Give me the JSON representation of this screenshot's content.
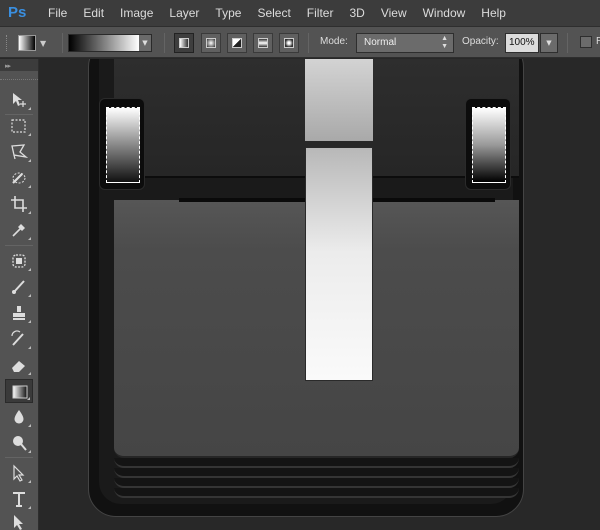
{
  "app": {
    "logo": "Ps"
  },
  "menu": [
    "File",
    "Edit",
    "Image",
    "Layer",
    "Type",
    "Select",
    "Filter",
    "3D",
    "View",
    "Window",
    "Help"
  ],
  "options": {
    "mode_label": "Mode:",
    "mode_value": "Normal",
    "opacity_label": "Opacity:",
    "opacity_value": "100%",
    "reverse_label": "R"
  },
  "tools": [
    "move-tool",
    "marquee-tool",
    "lasso-tool",
    "quick-selection-tool",
    "crop-tool",
    "eyedropper-tool",
    "healing-brush-tool",
    "brush-tool",
    "clone-stamp-tool",
    "history-brush-tool",
    "eraser-tool",
    "gradient-tool",
    "blur-tool",
    "dodge-tool",
    "path-selection-tool",
    "type-tool",
    "direct-selection-tool"
  ],
  "active_tool": "gradient-tool",
  "colors": {
    "menu_bg": "#3c3c3c",
    "panel_bg": "#535353",
    "canvas_bg": "#282828",
    "ps_blue": "#3a8fe0"
  }
}
